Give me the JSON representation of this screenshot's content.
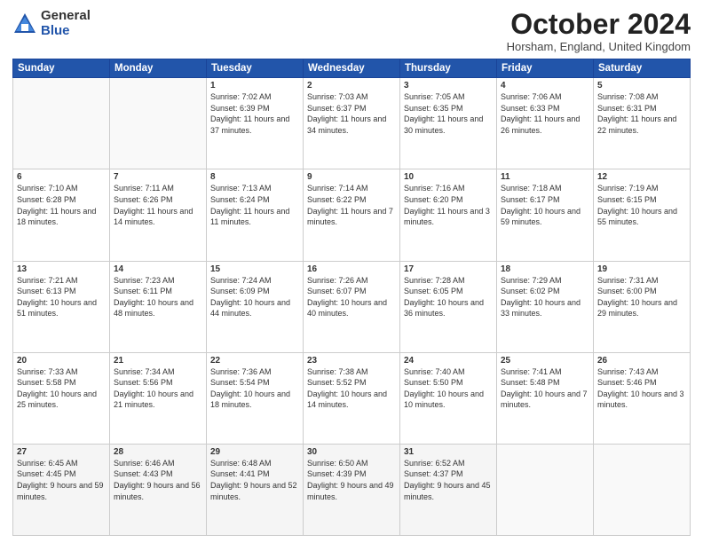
{
  "logo": {
    "general": "General",
    "blue": "Blue"
  },
  "header": {
    "title": "October 2024",
    "location": "Horsham, England, United Kingdom"
  },
  "weekdays": [
    "Sunday",
    "Monday",
    "Tuesday",
    "Wednesday",
    "Thursday",
    "Friday",
    "Saturday"
  ],
  "weeks": [
    [
      {
        "day": "",
        "info": ""
      },
      {
        "day": "",
        "info": ""
      },
      {
        "day": "1",
        "info": "Sunrise: 7:02 AM\nSunset: 6:39 PM\nDaylight: 11 hours\nand 37 minutes."
      },
      {
        "day": "2",
        "info": "Sunrise: 7:03 AM\nSunset: 6:37 PM\nDaylight: 11 hours\nand 34 minutes."
      },
      {
        "day": "3",
        "info": "Sunrise: 7:05 AM\nSunset: 6:35 PM\nDaylight: 11 hours\nand 30 minutes."
      },
      {
        "day": "4",
        "info": "Sunrise: 7:06 AM\nSunset: 6:33 PM\nDaylight: 11 hours\nand 26 minutes."
      },
      {
        "day": "5",
        "info": "Sunrise: 7:08 AM\nSunset: 6:31 PM\nDaylight: 11 hours\nand 22 minutes."
      }
    ],
    [
      {
        "day": "6",
        "info": "Sunrise: 7:10 AM\nSunset: 6:28 PM\nDaylight: 11 hours\nand 18 minutes."
      },
      {
        "day": "7",
        "info": "Sunrise: 7:11 AM\nSunset: 6:26 PM\nDaylight: 11 hours\nand 14 minutes."
      },
      {
        "day": "8",
        "info": "Sunrise: 7:13 AM\nSunset: 6:24 PM\nDaylight: 11 hours\nand 11 minutes."
      },
      {
        "day": "9",
        "info": "Sunrise: 7:14 AM\nSunset: 6:22 PM\nDaylight: 11 hours\nand 7 minutes."
      },
      {
        "day": "10",
        "info": "Sunrise: 7:16 AM\nSunset: 6:20 PM\nDaylight: 11 hours\nand 3 minutes."
      },
      {
        "day": "11",
        "info": "Sunrise: 7:18 AM\nSunset: 6:17 PM\nDaylight: 10 hours\nand 59 minutes."
      },
      {
        "day": "12",
        "info": "Sunrise: 7:19 AM\nSunset: 6:15 PM\nDaylight: 10 hours\nand 55 minutes."
      }
    ],
    [
      {
        "day": "13",
        "info": "Sunrise: 7:21 AM\nSunset: 6:13 PM\nDaylight: 10 hours\nand 51 minutes."
      },
      {
        "day": "14",
        "info": "Sunrise: 7:23 AM\nSunset: 6:11 PM\nDaylight: 10 hours\nand 48 minutes."
      },
      {
        "day": "15",
        "info": "Sunrise: 7:24 AM\nSunset: 6:09 PM\nDaylight: 10 hours\nand 44 minutes."
      },
      {
        "day": "16",
        "info": "Sunrise: 7:26 AM\nSunset: 6:07 PM\nDaylight: 10 hours\nand 40 minutes."
      },
      {
        "day": "17",
        "info": "Sunrise: 7:28 AM\nSunset: 6:05 PM\nDaylight: 10 hours\nand 36 minutes."
      },
      {
        "day": "18",
        "info": "Sunrise: 7:29 AM\nSunset: 6:02 PM\nDaylight: 10 hours\nand 33 minutes."
      },
      {
        "day": "19",
        "info": "Sunrise: 7:31 AM\nSunset: 6:00 PM\nDaylight: 10 hours\nand 29 minutes."
      }
    ],
    [
      {
        "day": "20",
        "info": "Sunrise: 7:33 AM\nSunset: 5:58 PM\nDaylight: 10 hours\nand 25 minutes."
      },
      {
        "day": "21",
        "info": "Sunrise: 7:34 AM\nSunset: 5:56 PM\nDaylight: 10 hours\nand 21 minutes."
      },
      {
        "day": "22",
        "info": "Sunrise: 7:36 AM\nSunset: 5:54 PM\nDaylight: 10 hours\nand 18 minutes."
      },
      {
        "day": "23",
        "info": "Sunrise: 7:38 AM\nSunset: 5:52 PM\nDaylight: 10 hours\nand 14 minutes."
      },
      {
        "day": "24",
        "info": "Sunrise: 7:40 AM\nSunset: 5:50 PM\nDaylight: 10 hours\nand 10 minutes."
      },
      {
        "day": "25",
        "info": "Sunrise: 7:41 AM\nSunset: 5:48 PM\nDaylight: 10 hours\nand 7 minutes."
      },
      {
        "day": "26",
        "info": "Sunrise: 7:43 AM\nSunset: 5:46 PM\nDaylight: 10 hours\nand 3 minutes."
      }
    ],
    [
      {
        "day": "27",
        "info": "Sunrise: 6:45 AM\nSunset: 4:45 PM\nDaylight: 9 hours\nand 59 minutes."
      },
      {
        "day": "28",
        "info": "Sunrise: 6:46 AM\nSunset: 4:43 PM\nDaylight: 9 hours\nand 56 minutes."
      },
      {
        "day": "29",
        "info": "Sunrise: 6:48 AM\nSunset: 4:41 PM\nDaylight: 9 hours\nand 52 minutes."
      },
      {
        "day": "30",
        "info": "Sunrise: 6:50 AM\nSunset: 4:39 PM\nDaylight: 9 hours\nand 49 minutes."
      },
      {
        "day": "31",
        "info": "Sunrise: 6:52 AM\nSunset: 4:37 PM\nDaylight: 9 hours\nand 45 minutes."
      },
      {
        "day": "",
        "info": ""
      },
      {
        "day": "",
        "info": ""
      }
    ]
  ]
}
